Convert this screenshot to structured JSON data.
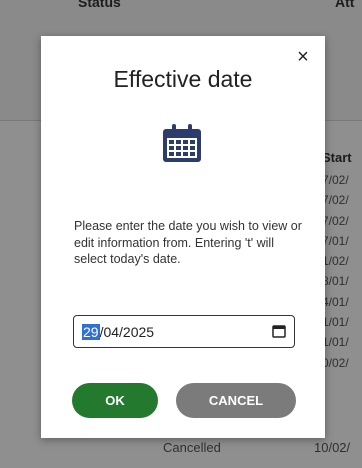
{
  "background": {
    "columns": {
      "status": "Status",
      "att": "Att"
    },
    "start_header": "Start",
    "start_dates": [
      "7/02/",
      "7/02/",
      "7/02/",
      "7/01/",
      "1/02/",
      "8/01/",
      "4/01/",
      "1/01/",
      "1/01/",
      "0/02/"
    ],
    "last_row": {
      "status": "Cancelled",
      "date": "10/02/"
    }
  },
  "dialog": {
    "close_glyph": "×",
    "title": "Effective date",
    "icon": "calendar-icon",
    "prompt": "Please enter the date you wish to view or edit information from. Entering 't' will select today's date.",
    "date_field": {
      "day": "29",
      "rest": "/04/2025"
    },
    "ok_label": "OK",
    "cancel_label": "CANCEL"
  },
  "colors": {
    "ok_button": "#237a2f",
    "cancel_button": "#7b7b7b",
    "calendar_icon": "#2d3d6b",
    "selection": "#2f6fd6"
  }
}
